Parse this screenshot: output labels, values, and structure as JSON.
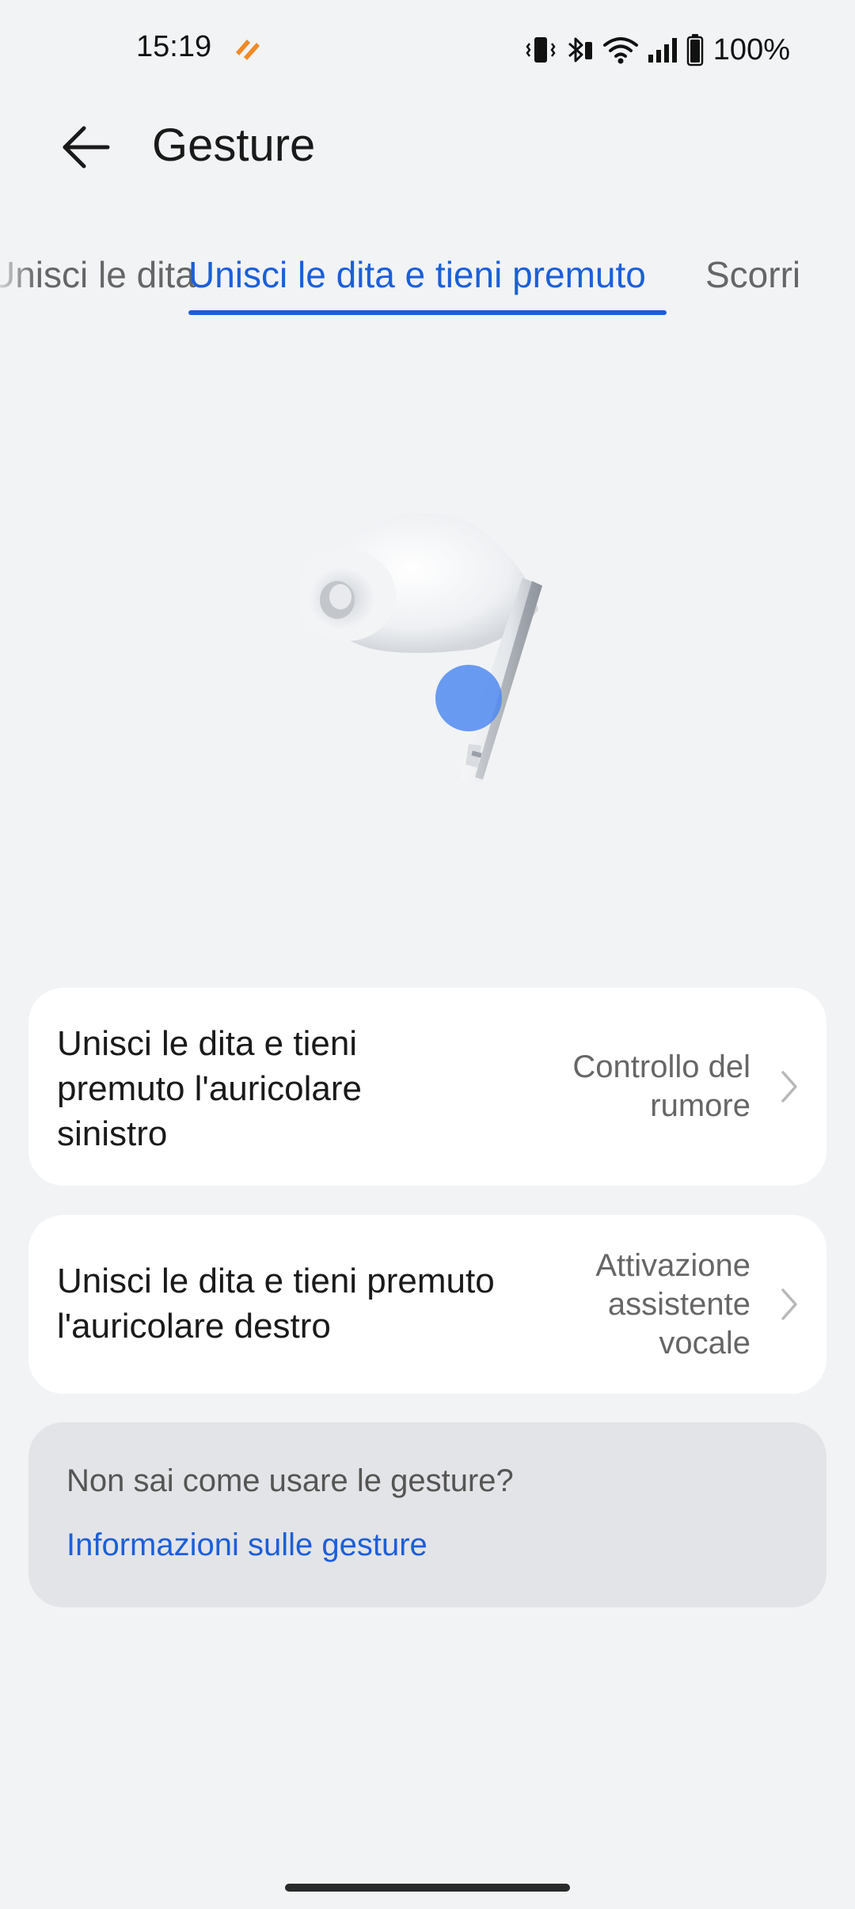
{
  "status_bar": {
    "time": "15:19",
    "battery": "100%",
    "icons": [
      "app-notification-icon",
      "vibrate-icon",
      "bluetooth-icon",
      "wifi-icon",
      "cellular-signal-icon",
      "battery-icon"
    ]
  },
  "header": {
    "title": "Gesture",
    "back_icon": "back-arrow-icon"
  },
  "tabs": [
    {
      "label": "Unisci le dita",
      "state": "partially visible"
    },
    {
      "label": "Unisci le dita e tieni premuto",
      "state": "selected"
    },
    {
      "label": "Scorri",
      "state": "visible"
    }
  ],
  "illustration": {
    "subject": "earbud-image"
  },
  "settings": [
    {
      "label": "Unisci le dita e tieni premuto l'auricolare sinistro",
      "value": "Controllo del rumore"
    },
    {
      "label": "Unisci le dita e tieni premuto l'auricolare destro",
      "value": "Attivazione assistente vocale"
    }
  ],
  "help": {
    "question": "Non sai come usare le gesture?",
    "link": "Informazioni sulle gesture"
  },
  "colors": {
    "accent": "#1b5fd9",
    "background": "#f1f3f5",
    "card": "#ffffff",
    "help_box": "#e3e4e7"
  }
}
